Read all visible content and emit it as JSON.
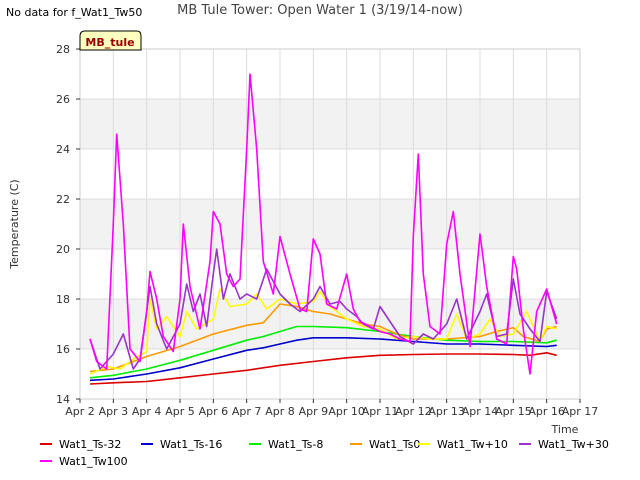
{
  "nodata_text": "No data for f_Wat1_Tw50",
  "chart_data": {
    "type": "line",
    "title": "MB Tule Tower: Open Water 1 (3/19/14-now)",
    "site_tag": "MB_tule",
    "xlabel": "Time",
    "ylabel": "Temperature (C)",
    "xlim": [
      2,
      17
    ],
    "ylim": [
      14,
      28
    ],
    "x_ticks": [
      2,
      3,
      4,
      5,
      6,
      7,
      8,
      9,
      10,
      11,
      12,
      13,
      14,
      15,
      16,
      17
    ],
    "x_tick_labels": [
      "Apr 2",
      "Apr 3",
      "Apr 4",
      "Apr 5",
      "Apr 6",
      "Apr 7",
      "Apr 8",
      "Apr 9",
      "Apr 10",
      "Apr 11",
      "Apr 12",
      "Apr 13",
      "Apr 14",
      "Apr 15",
      "Apr 16",
      "Apr 17"
    ],
    "y_ticks": [
      14,
      16,
      18,
      20,
      22,
      24,
      26,
      28
    ],
    "grid": true,
    "legend_position": "bottom",
    "series": [
      {
        "name": "Wat1_Ts-32",
        "color": "#dd0000",
        "x": [
          2.3,
          3,
          4,
          5,
          6,
          7,
          8,
          9,
          10,
          11,
          12,
          13,
          14,
          15,
          15.5,
          16,
          16.3
        ],
        "y": [
          14.6,
          14.65,
          14.7,
          14.85,
          15.0,
          15.15,
          15.35,
          15.5,
          15.65,
          15.75,
          15.78,
          15.8,
          15.8,
          15.78,
          15.75,
          15.85,
          15.75
        ]
      },
      {
        "name": "Wat1_Ts-16",
        "color": "#0000cc",
        "x": [
          2.3,
          3,
          4,
          5,
          6,
          7,
          7.5,
          8,
          8.5,
          9,
          10,
          11,
          12,
          13,
          14,
          15,
          16,
          16.3
        ],
        "y": [
          14.75,
          14.8,
          15.0,
          15.25,
          15.6,
          15.95,
          16.05,
          16.2,
          16.35,
          16.45,
          16.45,
          16.4,
          16.3,
          16.2,
          16.2,
          16.15,
          16.1,
          16.15
        ]
      },
      {
        "name": "Wat1_Ts-8",
        "color": "#00ee00",
        "x": [
          2.3,
          3,
          4,
          5,
          6,
          7,
          7.5,
          8,
          8.5,
          9,
          10,
          11,
          12,
          13,
          14,
          15,
          16,
          16.3
        ],
        "y": [
          14.85,
          14.95,
          15.2,
          15.55,
          15.95,
          16.35,
          16.5,
          16.7,
          16.9,
          16.9,
          16.85,
          16.7,
          16.5,
          16.35,
          16.3,
          16.3,
          16.25,
          16.35
        ]
      },
      {
        "name": "Wat1_Ts0",
        "color": "#ff9900",
        "x": [
          2.3,
          3,
          4,
          4.5,
          5,
          6,
          7,
          7.5,
          8,
          8.5,
          9,
          9.5,
          10,
          10.5,
          11,
          11.5,
          12,
          13,
          14,
          14.5,
          15,
          15.3,
          15.8,
          16,
          16.3
        ],
        "y": [
          15.1,
          15.2,
          15.7,
          15.9,
          16.1,
          16.6,
          16.95,
          17.05,
          17.8,
          17.7,
          17.5,
          17.4,
          17.2,
          17.0,
          16.9,
          16.6,
          16.4,
          16.4,
          16.5,
          16.7,
          16.85,
          16.5,
          16.3,
          16.8,
          16.9
        ]
      },
      {
        "name": "Wat1_Tw+10",
        "color": "#ffff00",
        "x": [
          2.3,
          2.8,
          3.2,
          3.6,
          4.0,
          4.1,
          4.3,
          4.6,
          5.0,
          5.2,
          5.5,
          6.0,
          6.2,
          6.5,
          7.0,
          7.3,
          7.6,
          8.0,
          8.5,
          9.0,
          9.2,
          9.5,
          10.0,
          10.5,
          11.0,
          11.5,
          12.0,
          12.5,
          13.0,
          13.3,
          13.6,
          14.0,
          14.3,
          14.6,
          15.0,
          15.4,
          15.8,
          16.0,
          16.3
        ],
        "y": [
          15.0,
          15.3,
          15.2,
          15.6,
          15.9,
          18.0,
          16.8,
          17.3,
          16.5,
          17.5,
          16.8,
          17.2,
          18.4,
          17.7,
          17.8,
          18.2,
          17.6,
          18.0,
          17.8,
          17.9,
          18.3,
          17.7,
          17.2,
          16.9,
          16.8,
          16.4,
          16.5,
          16.4,
          16.4,
          17.4,
          16.4,
          16.6,
          17.2,
          16.5,
          16.6,
          17.5,
          16.3,
          16.9,
          16.8
        ]
      },
      {
        "name": "Wat1_Tw+30",
        "color": "#9933cc",
        "x": [
          2.3,
          2.6,
          3.0,
          3.3,
          3.6,
          3.8,
          4.0,
          4.1,
          4.3,
          4.6,
          5.0,
          5.2,
          5.4,
          5.6,
          5.8,
          6.0,
          6.1,
          6.3,
          6.5,
          6.8,
          7.0,
          7.3,
          7.6,
          8.0,
          8.3,
          8.6,
          9.0,
          9.2,
          9.5,
          9.8,
          10.0,
          10.3,
          10.5,
          10.8,
          11.0,
          11.3,
          11.6,
          12.0,
          12.3,
          12.6,
          13.0,
          13.3,
          13.6,
          14.0,
          14.2,
          14.5,
          14.8,
          15.0,
          15.2,
          15.5,
          15.8,
          16.0,
          16.3
        ],
        "y": [
          16.4,
          15.2,
          15.8,
          16.6,
          15.2,
          15.6,
          17.5,
          18.5,
          17.0,
          16.0,
          17.0,
          18.6,
          17.5,
          18.2,
          16.9,
          19.0,
          20.0,
          18.0,
          19.0,
          18.0,
          18.2,
          18.0,
          19.2,
          18.2,
          17.8,
          17.5,
          18.0,
          18.5,
          17.8,
          17.9,
          17.6,
          17.3,
          17.0,
          16.8,
          17.7,
          17.1,
          16.5,
          16.2,
          16.6,
          16.4,
          17.0,
          18.0,
          16.4,
          17.5,
          18.2,
          16.5,
          16.6,
          18.8,
          17.4,
          16.8,
          16.3,
          18.3,
          17.2
        ]
      },
      {
        "name": "Wat1_Tw100",
        "color": "#ff00ff",
        "x": [
          2.3,
          2.5,
          2.8,
          3.0,
          3.1,
          3.3,
          3.5,
          3.8,
          4.0,
          4.1,
          4.3,
          4.5,
          4.8,
          5.0,
          5.1,
          5.3,
          5.6,
          5.9,
          6.0,
          6.2,
          6.4,
          6.6,
          6.8,
          7.0,
          7.1,
          7.3,
          7.5,
          7.8,
          8.0,
          8.3,
          8.6,
          8.8,
          9.0,
          9.2,
          9.4,
          9.7,
          10.0,
          10.2,
          10.4,
          10.7,
          11.0,
          11.3,
          11.6,
          11.9,
          12.0,
          12.15,
          12.3,
          12.5,
          12.8,
          13.0,
          13.2,
          13.4,
          13.7,
          14.0,
          14.2,
          14.5,
          14.8,
          15.0,
          15.1,
          15.3,
          15.5,
          15.7,
          16.0,
          16.3
        ],
        "y": [
          16.4,
          15.5,
          15.2,
          21.0,
          24.6,
          21.0,
          16.0,
          15.5,
          17.5,
          19.1,
          18.0,
          16.5,
          15.9,
          18.0,
          21.0,
          18.5,
          16.8,
          19.5,
          21.5,
          21.0,
          19.0,
          18.5,
          18.8,
          24.0,
          27.0,
          24.0,
          19.5,
          18.2,
          20.5,
          19.0,
          17.6,
          17.5,
          20.4,
          19.8,
          17.8,
          17.6,
          19.0,
          17.6,
          17.1,
          16.9,
          16.7,
          16.6,
          16.4,
          16.3,
          20.5,
          23.8,
          19.0,
          16.9,
          16.6,
          20.2,
          21.5,
          19.0,
          16.1,
          20.6,
          18.5,
          16.4,
          16.2,
          19.7,
          19.2,
          16.8,
          15.0,
          17.5,
          18.4,
          17.0
        ]
      }
    ]
  }
}
